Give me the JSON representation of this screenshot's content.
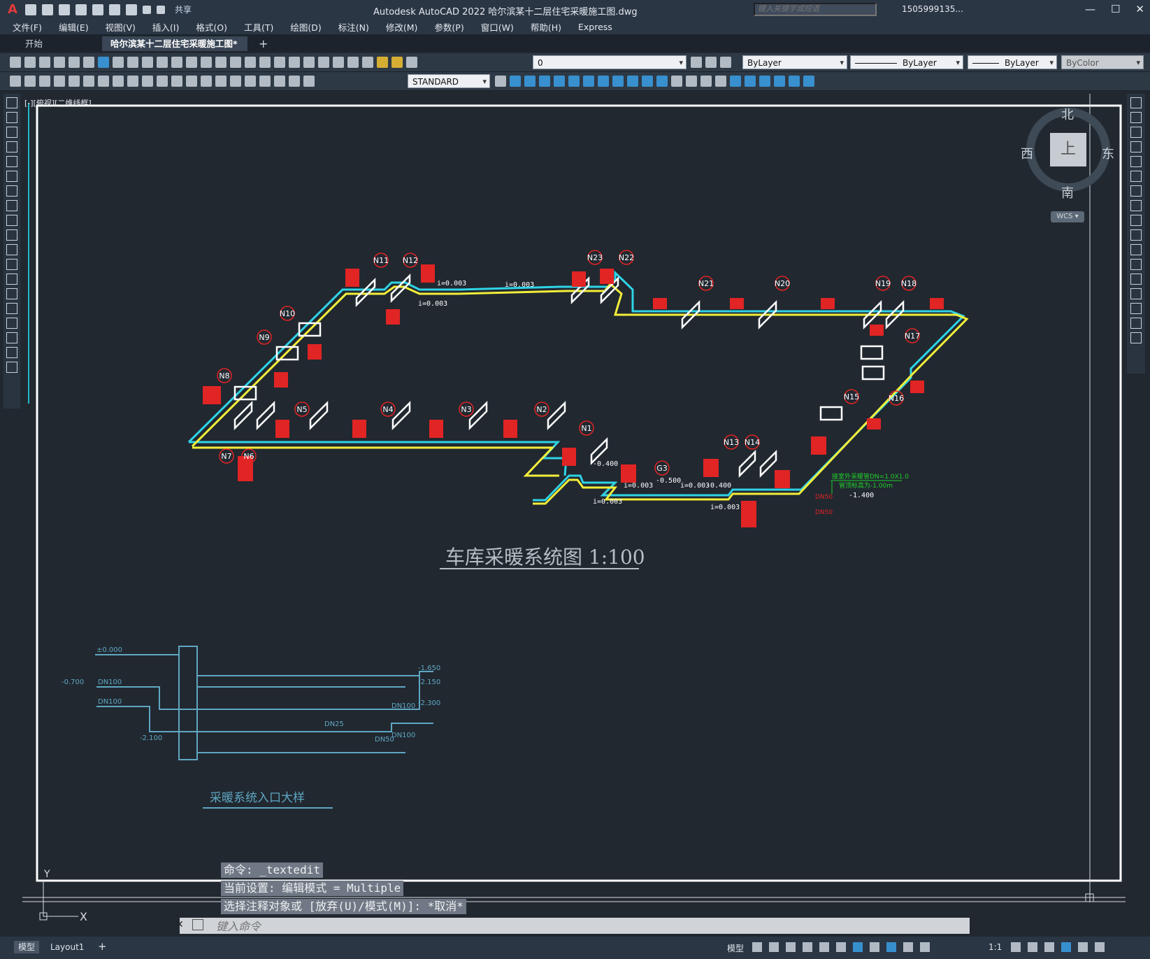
{
  "window": {
    "app_logo": "A",
    "share_label": "共享",
    "title": "Autodesk AutoCAD 2022    哈尔滨某十二层住宅采暖施工图.dwg",
    "search_placeholder": "键入关键字或短语",
    "user": "1505999135...",
    "controls": [
      "—",
      "☐",
      "✕"
    ]
  },
  "menu": [
    "文件(F)",
    "编辑(E)",
    "视图(V)",
    "插入(I)",
    "格式(O)",
    "工具(T)",
    "绘图(D)",
    "标注(N)",
    "修改(M)",
    "参数(P)",
    "窗口(W)",
    "帮助(H)",
    "Express"
  ],
  "tabs": {
    "start": "开始",
    "active": "哈尔滨某十二层住宅采暖施工图*",
    "close": "✕",
    "add": "+"
  },
  "toolbar": {
    "layer": "0",
    "color": "ByLayer",
    "linetype": "ByLayer",
    "lineweight": "ByLayer",
    "plotstyle": "ByColor",
    "textstyle": "STANDARD"
  },
  "viewport_label": "[-][俯视][二维线框]",
  "viewcube": {
    "north": "北",
    "south": "南",
    "east": "东",
    "west": "西",
    "top": "上",
    "wcs": "WCS ▾"
  },
  "drawing": {
    "main_title": "车库采暖系统图 1:100",
    "detail_title": "采暖系统入口大样",
    "node_labels": [
      {
        "id": "N11"
      },
      {
        "id": "N12"
      },
      {
        "id": "N23"
      },
      {
        "id": "N22"
      },
      {
        "id": "N21"
      },
      {
        "id": "N20"
      },
      {
        "id": "N19"
      },
      {
        "id": "N18"
      },
      {
        "id": "N17"
      },
      {
        "id": "N10"
      },
      {
        "id": "N9"
      },
      {
        "id": "N8"
      },
      {
        "id": "N5"
      },
      {
        "id": "N4"
      },
      {
        "id": "N3"
      },
      {
        "id": "N2"
      },
      {
        "id": "N1"
      },
      {
        "id": "N7"
      },
      {
        "id": "N6"
      },
      {
        "id": "N15"
      },
      {
        "id": "N16"
      },
      {
        "id": "N13"
      },
      {
        "id": "N14"
      },
      {
        "id": "G3"
      }
    ],
    "slope_labels": [
      "i=0.003",
      "i=0.003",
      "i=0.003",
      "i=0.003",
      "i=0.003",
      "i=0.003",
      "i=0.003"
    ],
    "elevations": [
      "-0.400",
      "-0.500",
      "-0.400",
      "-1.400"
    ],
    "pipe_labels": [
      "DN50",
      "DN50"
    ],
    "green_note": "接室外采暖管DN=1.0X1.0",
    "green_note2": "管顶标高为-1.00m",
    "detail_elevations": [
      "±0.000",
      "-0.700",
      "-2.100",
      "-1.650",
      "-2.150",
      "-2.300"
    ],
    "detail_pipes": [
      "DN100",
      "DN100",
      "DN100",
      "DN100",
      "DN25",
      "DN50"
    ]
  },
  "command": {
    "history": [
      "命令: _textedit",
      "当前设置: 编辑模式 = Multiple",
      "选择注释对象或 [放弃(U)/模式(M)]: *取消*"
    ],
    "placeholder": "键入命令",
    "close": "✕"
  },
  "status": {
    "model_tab": "模型",
    "layout_tab": "Layout1",
    "add": "+",
    "model_space": "模型",
    "scale": "1:1"
  },
  "ucs": {
    "x": "X",
    "y": "Y"
  },
  "colors": {
    "cyan": "#2fd3e6",
    "yellow": "#f2ee3a",
    "red": "#e12424",
    "white": "#ffffff",
    "detail": "#5fa7c2",
    "green": "#1fd12a",
    "bg": "#212830"
  }
}
